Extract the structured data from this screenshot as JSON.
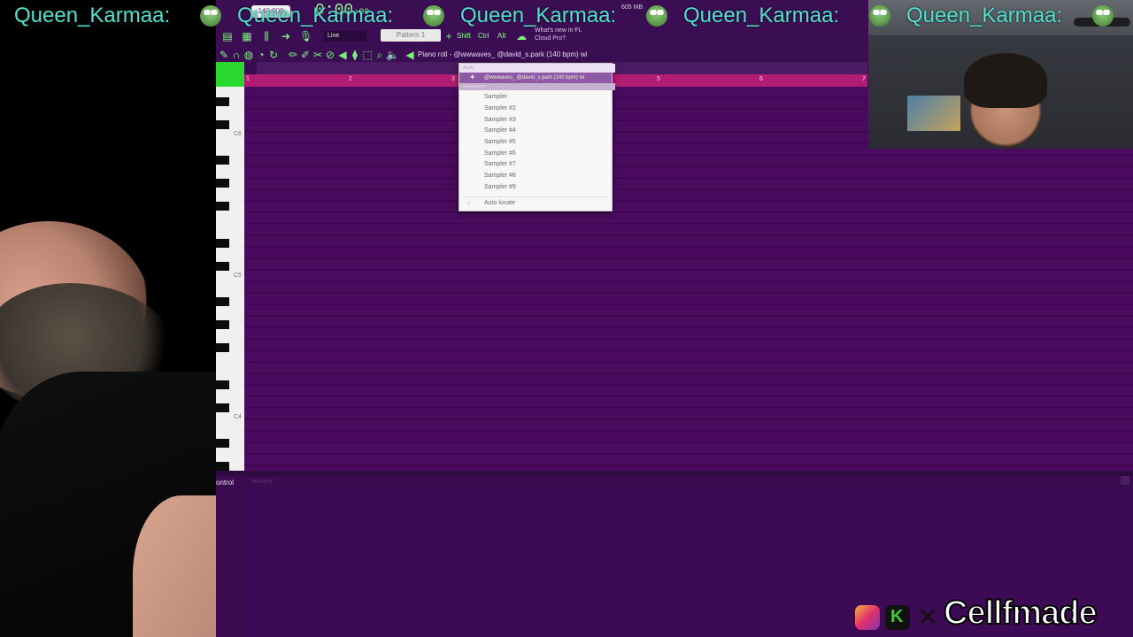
{
  "chat_overlay": {
    "username": "Queen_Karmaa:",
    "emote": "frog-emote-icon"
  },
  "toolbar": {
    "tempo_value": "140.000",
    "time_display": "0:00",
    "time_sub": ":00",
    "snap_mode": "Line",
    "pattern": "Pattern 1",
    "shift_label": "Shift",
    "ctrl_label": "Ctrl",
    "alt_label": "Alt",
    "news_line1": "What's new in FL",
    "news_line2": "Cloud Pro?",
    "memory": "605 MB"
  },
  "piano_roll": {
    "title": "Piano roll - @wwwaves_ @david_s.park (140 bpm) wi",
    "ruler_numbers": [
      "1",
      "2",
      "3",
      "4",
      "5",
      "6",
      "7"
    ],
    "key_labels": [
      "C6",
      "C5",
      "C4"
    ],
    "event_editor_label": "ontrol",
    "event_editor_sub": "Velocity"
  },
  "dropdown": {
    "section_audio": "Audio",
    "selected_item": "@wwwaves_ @david_s.park (140 bpm) wi",
    "section_generators": "Generators",
    "items": [
      "Sampler",
      "Sampler #2",
      "Sampler #3",
      "Sampler #4",
      "Sampler #5",
      "Sampler #6",
      "Sampler #7",
      "Sampler #8",
      "Sampler #9"
    ],
    "auto_locate": "Auto locate"
  },
  "branding": {
    "name": "Cellfmade",
    "icons": [
      "instagram-icon",
      "kick-icon",
      "x-icon"
    ]
  },
  "colors": {
    "grid": "#4a0b5e",
    "ruler": "#b21c72",
    "accent_green": "#29d92f",
    "chat_text": "#53e1cf"
  }
}
